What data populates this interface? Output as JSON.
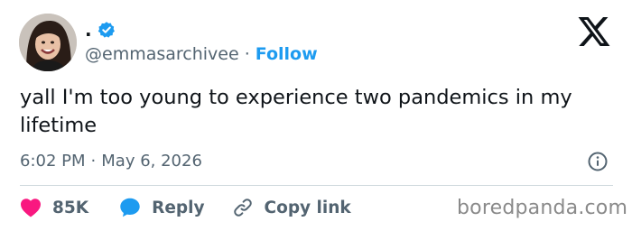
{
  "tweet": {
    "display_name": ".",
    "handle": "@emmasarchivee",
    "separator": "·",
    "follow_label": "Follow",
    "text": "yall I'm too young to experience two pandemics in my lifetime",
    "time": "6:02 PM",
    "date": "May 6, 2026"
  },
  "actions": {
    "like_count": "85K",
    "reply_label": "Reply",
    "copy_link_label": "Copy link"
  },
  "watermark": "boredpanda.com",
  "colors": {
    "accent": "#1d9bf0",
    "like": "#f91880",
    "text": "#0f1419",
    "muted": "#536471"
  },
  "icons": [
    "verified-badge-icon",
    "x-logo-icon",
    "info-icon",
    "heart-icon",
    "reply-bubble-icon",
    "link-icon"
  ]
}
